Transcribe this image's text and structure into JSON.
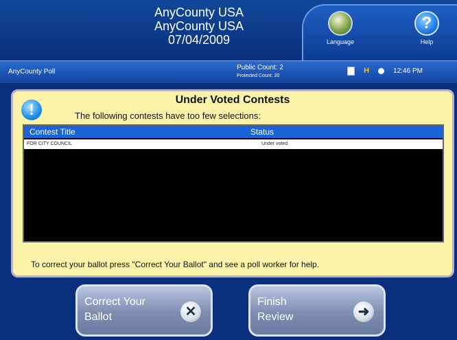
{
  "header": {
    "line1": "AnyCounty USA",
    "line2": "AnyCounty USA",
    "date": "07/04/2009",
    "language_label": "Language",
    "help_label": "Help"
  },
  "status_bar": {
    "poll_name": "AnyCounty Poll",
    "public_count": "Public Count: 2",
    "protected_count": "Protected Count: 20",
    "time": "12:46 PM"
  },
  "panel": {
    "title": "Under Voted Contests",
    "subtitle": "The following contests have too few selections:",
    "table": {
      "columns": [
        "Contest Title",
        "Status"
      ],
      "rows": [
        {
          "contest": "FOR CITY COUNCIL",
          "status": "Under voted"
        }
      ]
    },
    "instruction": "To correct your ballot press \"Correct Your Ballot\" and see a poll worker for help."
  },
  "buttons": {
    "correct": {
      "line1": "Correct Your",
      "line2": "Ballot",
      "icon": "x-icon"
    },
    "finish": {
      "line1": "Finish",
      "line2": "Review",
      "icon": "arrow-right-icon"
    }
  }
}
